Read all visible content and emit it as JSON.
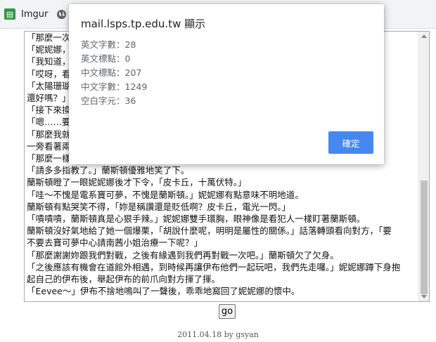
{
  "bookmarks": {
    "imgur_label": "Imgur"
  },
  "editor": {
    "lines": [
      "「那麼一次…",
      "「妮妮娜，",
      "「我知道，",
      "「哎呀，看",
      "「太陽珊瑚                                                                                       「掘掘兔",
      "還好嗎？」",
      "「接下來換",
      "「嗯……要先",
      "「那麼我就",
      "一旁看著兩",
      "「那麼一樣是先決定誰先攻，蘭斯頓加油喔～」妮妮娜眼中充滿笑意地道。",
      "「請多多指教了。」蘭斯頓優雅地笑了下。",
      "蘭斯頓瞪了一眼妮妮娜後才下令，「皮卡丘，十萬伏特。」",
      "「哇～不愧是電系寶可夢，不愧是蘭斯頓。」妮妮娜有點意味不明地道。",
      "蘭斯頓有點哭笑不得，「妳是稱讚還是貶低啊？皮卡丘，電光一閃。」",
      "「嘖嘖嘖，蘭斯頓真是心狠手辣。」妮妮娜雙手環胸，眼神像是看犯人一樣盯著蘭斯頓。",
      "蘭斯頓沒好氣地給了她一個爆栗，「胡說什麼呢，明明是屬性的關係。」話落轉頭看向對方，「要",
      "不要去寶可夢中心請南茜小姐治療一下呢？」",
      "「那麼謝謝妳跟我們對戰，之後有緣遇到我們再對戰一次吧。」蘭斯頓欠了欠身。",
      "「之後應該有機會在道館外相遇，到時候再讓伊布他們一起玩吧，我們先走囉。」妮妮娜蹲下身抱",
      "起自己的伊布後，舉起伊布的前爪向對方揮了揮。",
      "「Eevee～」伊布不捨地鳴叫了一聲後，乖乖地窩回了妮妮娜的懷中。"
    ]
  },
  "go_label": "go",
  "footer": "2011.04.18 by gsyan",
  "dialog": {
    "title": "mail.lsps.tp.edu.tw 顯示",
    "stats": [
      "英文字數：28",
      "英文標點：0",
      "中文標點：207",
      "中文字數：1249",
      "空白字元：36"
    ],
    "ok_label": "確定"
  },
  "colors": {
    "ok_button": "#4688f1",
    "imgur_green": "#2b9a45"
  },
  "icons": [
    "imgur-icon",
    "globe-icon"
  ]
}
